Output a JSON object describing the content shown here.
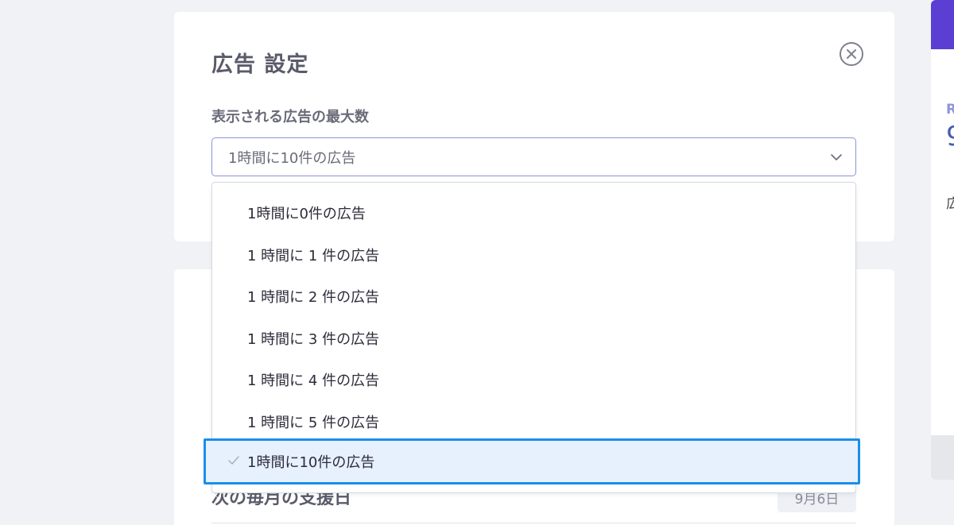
{
  "modal": {
    "title": "広告 設定",
    "field_label": "表示される広告の最大数",
    "select_value": "1時間に10件の広告"
  },
  "dropdown": {
    "options": [
      "1時間に0件の広告",
      "1 時間に 1 件の広告",
      "1 時間に 2 件の広告",
      "1 時間に 3 件の広告",
      "1 時間に 4 件の広告",
      "1 時間に 5 件の広告",
      "1時間に10件の広告"
    ],
    "selected_index": 6
  },
  "lower_card": {
    "heading": "次の毎月の支援日",
    "date": "9月6日"
  },
  "right_panel": {
    "letter": "R",
    "number": "9",
    "kanji": "広"
  },
  "colors": {
    "accent": "#1a8fe8",
    "select_border": "#8b94d8",
    "banner": "#5b3fd3",
    "selected_bg": "#e7f0fd"
  },
  "icons": {
    "close": "close-circle-icon",
    "chevron": "chevron-down-icon",
    "check": "check-icon"
  }
}
